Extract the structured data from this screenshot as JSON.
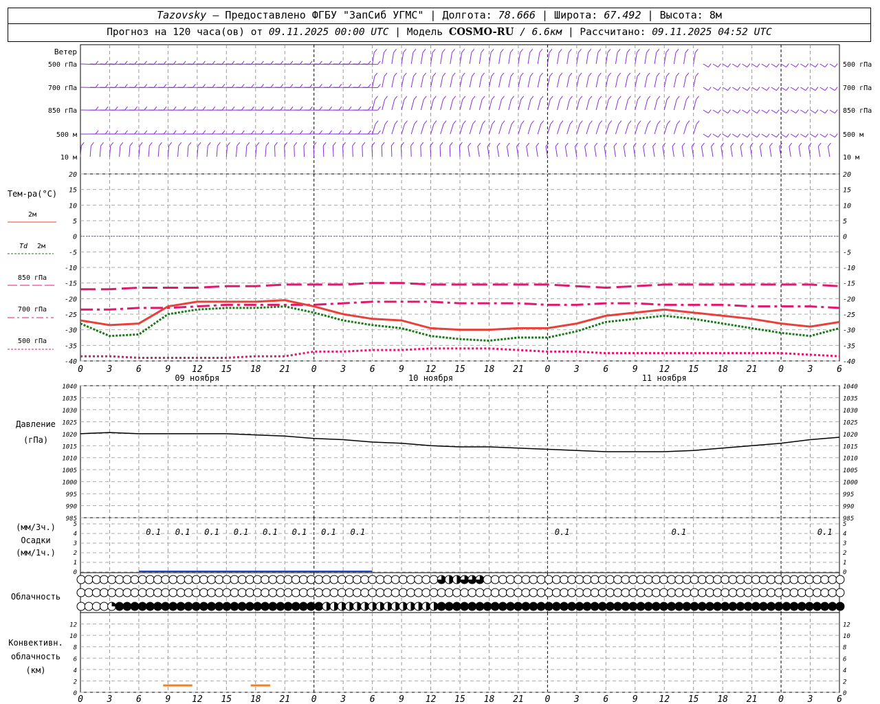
{
  "header": {
    "station": "Tazovsky",
    "provider": " — Предоставлено ФГБУ \"ЗапСиб УГМС\" | Долгота: ",
    "lon": "78.666",
    "lat_label": " | Широта: ",
    "lat": "67.492",
    "alt_label": " | Высота: ",
    "alt": "8м",
    "forecast_prefix": "Прогноз на 120 часа(ов) от ",
    "forecast_time": "09.11.2025 00:00 UTC",
    "model_prefix": "  | Модель ",
    "model": "COSMO-RU",
    "model_res": " / 6.6км",
    "calc_prefix": " | Рассчитано: ",
    "calc_time": "09.11.2025 04:52 UTC"
  },
  "labels": {
    "wind": "Ветер",
    "wind_levels": [
      "500 гПа",
      "700 гПа",
      "850 гПа",
      "500 м",
      "10  м"
    ],
    "temp": "Тем-ра(°C)",
    "legend_2m": "2м",
    "legend_td_a": "Td",
    "legend_td_b": "2м",
    "legend_850": "850 гПа",
    "legend_700": "700 гПа",
    "legend_500": "500 гПа",
    "pressure_a": "Давление",
    "pressure_b": "(гПа)",
    "precip_a": "(мм/3ч.)",
    "precip_b": "Осадки",
    "precip_c": "(мм/1ч.)",
    "cloud": "Облачность",
    "conv_a": "Конвективн.",
    "conv_b": "облачность",
    "conv_c": "(км)"
  },
  "colors": {
    "t2m": "#e8403a",
    "td2m": "#1a7a1a",
    "t850": "#e0186e",
    "t700": "#e0186e",
    "t500": "#e0186e",
    "wind": "#8a2be2",
    "zero": "#3a5fd0",
    "conv": "#f08020",
    "precip": "#2040c0"
  },
  "chart_data": {
    "type": "line",
    "x_hours": [
      0,
      3,
      6,
      9,
      12,
      15,
      18,
      21,
      24,
      27,
      30,
      33,
      36,
      39,
      42,
      45,
      48,
      51,
      54,
      57,
      60,
      63,
      66,
      69,
      72,
      75,
      78
    ],
    "x_ticks": [
      "0",
      "3",
      "6",
      "9",
      "12",
      "15",
      "18",
      "21",
      "0",
      "3",
      "6",
      "9",
      "12",
      "15",
      "18",
      "21",
      "0",
      "3",
      "6",
      "9",
      "12",
      "15",
      "18",
      "21",
      "0",
      "3",
      "6"
    ],
    "day_labels": [
      {
        "hour": 12,
        "text": "09 ноября"
      },
      {
        "hour": 36,
        "text": "10 ноября"
      },
      {
        "hour": 60,
        "text": "11 ноября"
      }
    ],
    "temperature": {
      "ylim": [
        -40,
        20
      ],
      "ticks": [
        20,
        15,
        10,
        5,
        0,
        -5,
        -10,
        -15,
        -20,
        -25,
        -30,
        -35,
        -40
      ],
      "t2m": [
        -27,
        -28.5,
        -28,
        -22.5,
        -21,
        -21,
        -21,
        -20.5,
        -22.5,
        -25,
        -26.5,
        -27,
        -29.5,
        -30,
        -30,
        -29.5,
        -29.5,
        -28,
        -25.5,
        -24.5,
        -23.5,
        -24.5,
        -25.5,
        -26.5,
        -28,
        -29,
        -27.5
      ],
      "td2m": [
        -28,
        -32,
        -31.5,
        -25,
        -23.5,
        -23,
        -23,
        -22.5,
        -24.5,
        -27,
        -28.5,
        -29.5,
        -32,
        -33,
        -33.5,
        -32.5,
        -32.5,
        -30.5,
        -27.5,
        -26.5,
        -25.5,
        -26.5,
        -28,
        -29.5,
        -31,
        -32,
        -29.5
      ],
      "t850": [
        -17,
        -17,
        -16.5,
        -16.5,
        -16.5,
        -16,
        -16,
        -15.5,
        -15.5,
        -15.5,
        -15,
        -15,
        -15.5,
        -15.5,
        -15.5,
        -15.5,
        -15.5,
        -16,
        -16.5,
        -16,
        -15.5,
        -15.5,
        -15.5,
        -15.5,
        -15.5,
        -15.5,
        -16
      ],
      "t700": [
        -23.5,
        -23.5,
        -23,
        -23,
        -22.5,
        -22,
        -22,
        -22,
        -22,
        -21.5,
        -21,
        -21,
        -21,
        -21.5,
        -21.5,
        -21.5,
        -22,
        -22,
        -21.5,
        -21.5,
        -22,
        -22,
        -22,
        -22.5,
        -22.5,
        -22.5,
        -23
      ],
      "t500": [
        -38.5,
        -38.5,
        -39,
        -39,
        -39,
        -39,
        -38.5,
        -38.5,
        -37,
        -37,
        -36.5,
        -36.5,
        -36,
        -36,
        -36,
        -36.5,
        -37,
        -37,
        -37.5,
        -37.5,
        -37.5,
        -37.5,
        -37.5,
        -37.5,
        -37.5,
        -38,
        -38.5
      ]
    },
    "pressure": {
      "ylim": [
        985,
        1040
      ],
      "ticks": [
        1040,
        1035,
        1030,
        1025,
        1020,
        1015,
        1010,
        1005,
        1000,
        995,
        990,
        985
      ],
      "values": [
        1020,
        1020.5,
        1020,
        1020,
        1020,
        1020,
        1019.5,
        1019,
        1018,
        1017.5,
        1016.5,
        1016,
        1015,
        1014.5,
        1014.5,
        1014,
        1013.5,
        1013,
        1012.5,
        1012.5,
        1012.5,
        1013,
        1014,
        1015,
        1016,
        1017.5,
        1018.5
      ]
    },
    "precip": {
      "ylim": [
        0,
        5
      ],
      "ticks": [
        5,
        4,
        3,
        2,
        1,
        0
      ],
      "labels": [
        {
          "hour": 7.5,
          "text": "0.1"
        },
        {
          "hour": 10.5,
          "text": "0.1"
        },
        {
          "hour": 13.5,
          "text": "0.1"
        },
        {
          "hour": 16.5,
          "text": "0.1"
        },
        {
          "hour": 19.5,
          "text": "0.1"
        },
        {
          "hour": 22.5,
          "text": "0.1"
        },
        {
          "hour": 25.5,
          "text": "0.1"
        },
        {
          "hour": 28.5,
          "text": "0.1"
        },
        {
          "hour": 49.5,
          "text": "0.1"
        },
        {
          "hour": 61.5,
          "text": "0.1"
        },
        {
          "hour": 76.5,
          "text": "0.1"
        }
      ]
    },
    "convective": {
      "ylim": [
        0,
        14
      ],
      "ticks": [
        12,
        10,
        8,
        6,
        4,
        2,
        0
      ],
      "segments": [
        {
          "from": 8.5,
          "to": 11.5,
          "height": 1.2
        },
        {
          "from": 17.5,
          "to": 19.5,
          "height": 1.2
        }
      ]
    },
    "cloud_rows": {
      "low": "0000000000000000000000000000000000000000000000032233300000000000000000000000000000000000000000000000",
      "mid": "0000000000000000000000000000000000000000000000000000000000000000000000000000000000000000000000000000",
      "high": "0000144444444444444444444444444422222222222222244444444444444444444444444444444444444444444444444444"
    }
  }
}
